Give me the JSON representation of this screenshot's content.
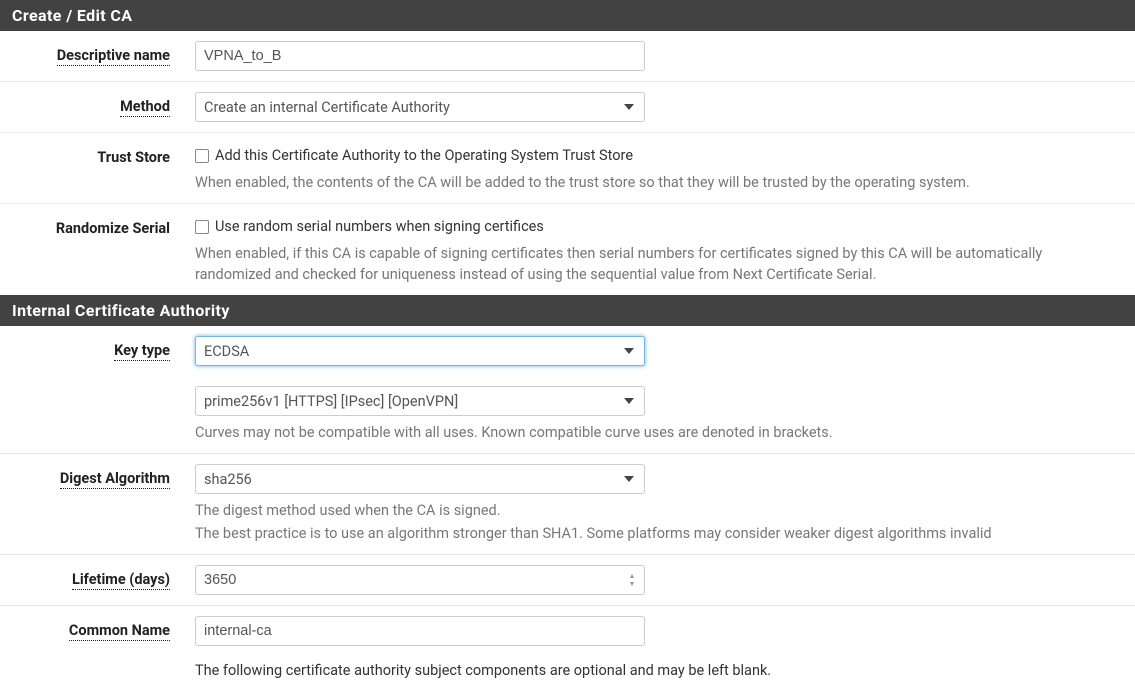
{
  "panel1": {
    "title": "Create / Edit CA",
    "descriptive_name": {
      "label": "Descriptive name",
      "value": "VPNA_to_B"
    },
    "method": {
      "label": "Method",
      "value": "Create an internal Certificate Authority"
    },
    "trust_store": {
      "label": "Trust Store",
      "checkbox_label": "Add this Certificate Authority to the Operating System Trust Store",
      "help": "When enabled, the contents of the CA will be added to the trust store so that they will be trusted by the operating system."
    },
    "randomize_serial": {
      "label": "Randomize Serial",
      "checkbox_label": "Use random serial numbers when signing certifices",
      "help": "When enabled, if this CA is capable of signing certificates then serial numbers for certificates signed by this CA will be automatically randomized and checked for uniqueness instead of using the sequential value from Next Certificate Serial."
    }
  },
  "panel2": {
    "title": "Internal Certificate Authority",
    "key_type": {
      "label": "Key type",
      "value": "ECDSA"
    },
    "curve": {
      "value": "prime256v1 [HTTPS] [IPsec] [OpenVPN]",
      "help": "Curves may not be compatible with all uses. Known compatible curve uses are denoted in brackets."
    },
    "digest": {
      "label": "Digest Algorithm",
      "value": "sha256",
      "help1": "The digest method used when the CA is signed.",
      "help2": "The best practice is to use an algorithm stronger than SHA1. Some platforms may consider weaker digest algorithms invalid"
    },
    "lifetime": {
      "label": "Lifetime (days)",
      "value": "3650"
    },
    "common_name": {
      "label": "Common Name",
      "value": "internal-ca"
    },
    "footer_note": "The following certificate authority subject components are optional and may be left blank."
  }
}
